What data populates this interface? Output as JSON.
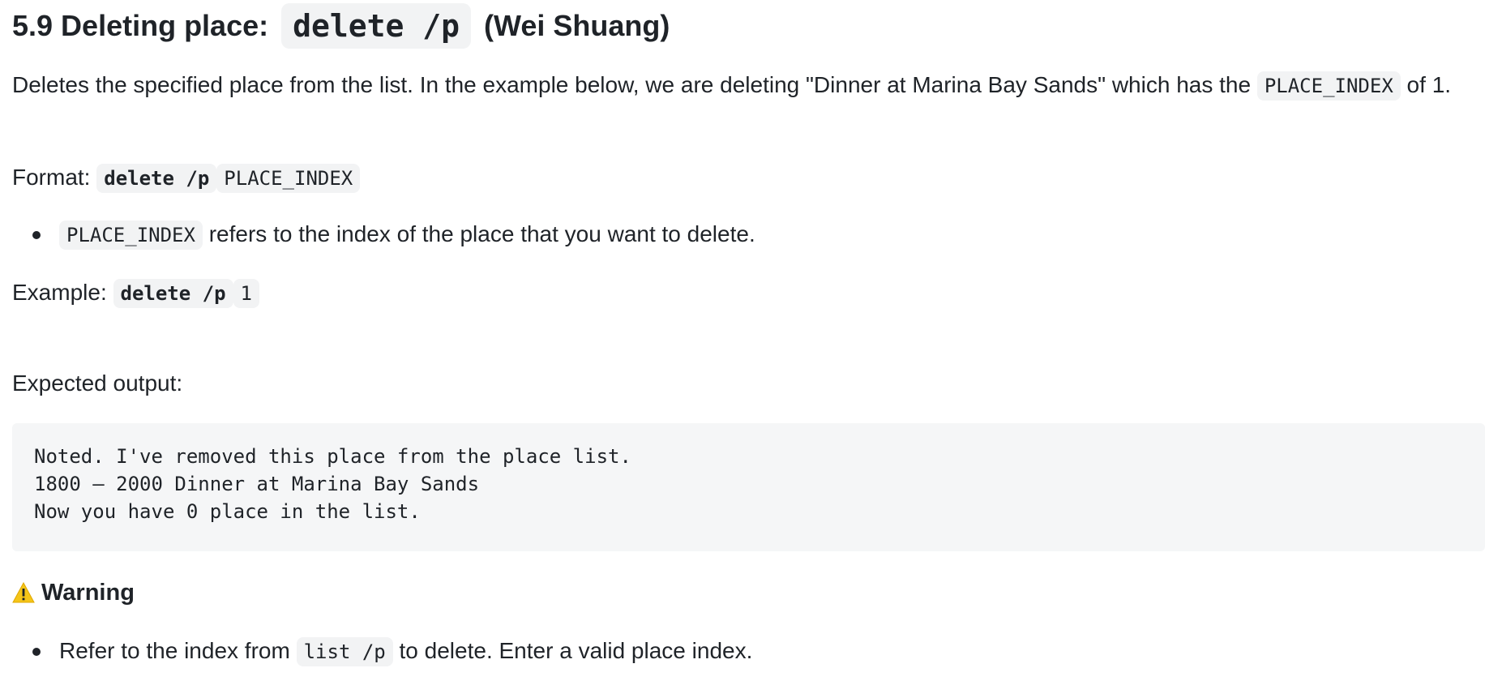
{
  "section": {
    "heading_prefix": "5.9 Deleting place:",
    "heading_code": "delete /p",
    "heading_suffix": "(Wei Shuang)"
  },
  "intro": {
    "text_before": "Deletes the specified place from the list. In the example below, we are deleting \"Dinner at Marina Bay Sands\" which has the ",
    "code": "PLACE_INDEX",
    "text_after": " of 1."
  },
  "format": {
    "label": "Format:",
    "command": "delete /p",
    "param": "PLACE_INDEX"
  },
  "param_notes": [
    {
      "code": "PLACE_INDEX",
      "text": "refers to the index of the place that you want to delete."
    }
  ],
  "example": {
    "label": "Example:",
    "command": "delete /p",
    "param": "1"
  },
  "expected": {
    "label": "Expected output:",
    "lines": [
      "Noted. I've removed this place from the place list.",
      "1800 – 2000 Dinner at Marina Bay Sands",
      "Now you have 0 place in the list."
    ]
  },
  "warning": {
    "icon": "warning-icon",
    "title": "Warning",
    "items": [
      {
        "text_before": "Refer to the index from",
        "code": "list /p",
        "text_after": "to delete. Enter a valid place index."
      }
    ]
  },
  "colors": {
    "text": "#1f2328",
    "code_bg": "#f2f3f4",
    "block_bg": "#f5f6f7",
    "warning_icon": "#f5c518"
  }
}
